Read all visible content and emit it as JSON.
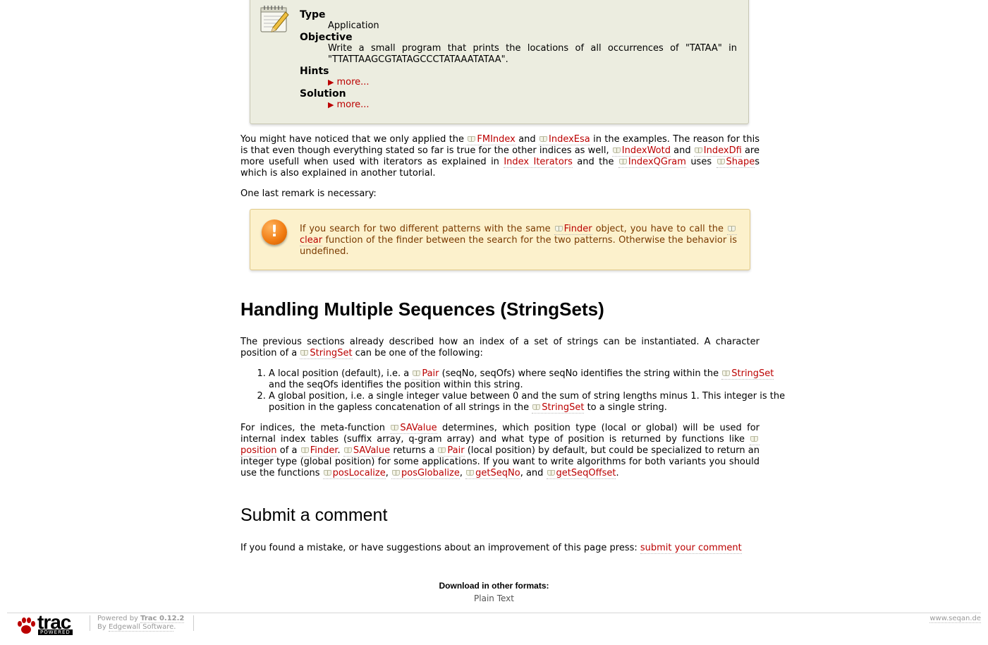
{
  "taskbox": {
    "type_label": "Type",
    "type_value": "Application",
    "objective_label": "Objective",
    "objective_value": "Write a small program that prints the locations of all occurrences of \"TATAA\" in \"TTATTAAGCGTATAGCCCTATAAATATAA\".",
    "hints_label": "Hints",
    "hints_more": "more...",
    "solution_label": "Solution",
    "solution_more": "more..."
  },
  "para1": {
    "t1": "You might have noticed that we only applied the ",
    "l1": "FMIndex",
    "t2": " and ",
    "l2": "IndexEsa",
    "t3": " in the examples. The reason for this is that even though everything stated so far is true for the other indices as well, ",
    "l3": "IndexWotd",
    "t4": " and ",
    "l4": "IndexDfi",
    "t5": " are more usefull when used with iterators as explained in ",
    "l5": "Index Iterators",
    "t6": " and the ",
    "l6": "IndexQGram",
    "t7": " uses ",
    "l7": "Shape",
    "t8": "s which is also explained in another tutorial."
  },
  "para2": "One last remark is necessary:",
  "warning": {
    "icon": "warning-icon",
    "t1": "If you search for two different patterns with the same ",
    "l1": "Finder",
    "t2": " object, you have to call the ",
    "l2": "clear",
    "t3": " function of the finder between the search for the two patterns. Otherwise the behavior is undefined."
  },
  "heading1": "Handling Multiple Sequences (StringSets)",
  "para3": {
    "t1": "The previous sections already described how an index of a set of strings can be instantiated. A character position of a ",
    "l1": "StringSet",
    "t2": " can be one of the following:"
  },
  "list": {
    "i1_t1": "A local position (default), i.e. a ",
    "i1_l1": "Pair",
    "i1_t2": " (seqNo, seqOfs) where seqNo identifies the string within the ",
    "i1_l2": "StringSet",
    "i1_t3": " and the seqOfs identifies the position within this string.",
    "i2_t1": "A global position, i.e. a single integer value between 0 and the sum of string lengths minus 1. This integer is the position in the gapless concatenation of all strings in the ",
    "i2_l1": "StringSet",
    "i2_t2": " to a single string."
  },
  "para4": {
    "t1": "For indices, the meta-function ",
    "l1": "SAValue",
    "t2": " determines, which position type (local or global) will be used for internal index tables (suffix array, q-gram array) and what type of position is returned by functions like ",
    "l2": "position",
    "t3": " of a ",
    "l3": "Finder",
    "t4": ". ",
    "l4": "SAValue",
    "t5": " returns a ",
    "l5": "Pair",
    "t6": " (local position) by default, but could be specialized to return an integer type (global position) for some applications. If you want to write algorithms for both variants you should use the functions ",
    "l6": "posLocalize",
    "t7": ", ",
    "l7": "posGlobalize",
    "t8": ", ",
    "l8": "getSeqNo",
    "t9": ", and ",
    "l9": "getSeqOffset",
    "t10": "."
  },
  "heading2": "Submit a comment",
  "para5": {
    "t1": "If you found a mistake, or have suggestions about an improvement of this page press: ",
    "l1": "submit your comment"
  },
  "downloads": {
    "title": "Download in other formats:",
    "item": "Plain Text"
  },
  "footer": {
    "logo_word": "trac",
    "logo_tag": "POWERED",
    "powered_by": "Powered by ",
    "trac_version": "Trac 0.12.2",
    "by": "By ",
    "edgewall": "Edgewall Software",
    "period": ".",
    "site": "www.seqan.de"
  }
}
